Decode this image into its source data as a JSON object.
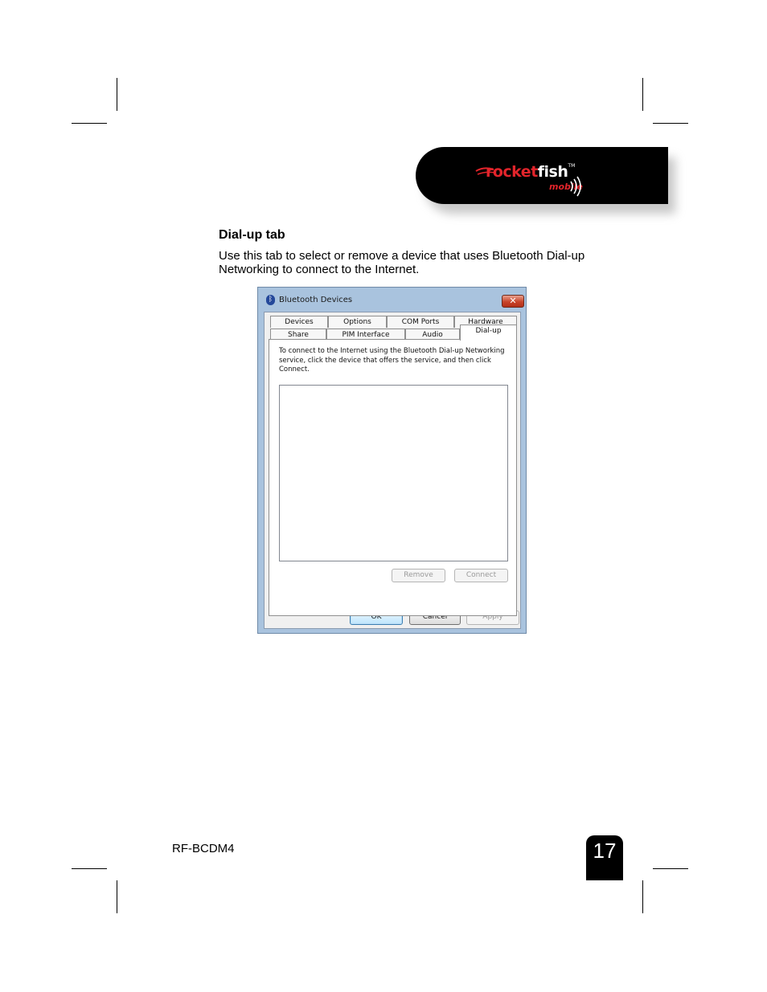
{
  "header": {
    "logo_rocket": "rocket",
    "logo_fish": "fish",
    "logo_tm": "TM",
    "logo_mobile": "mobile"
  },
  "section": {
    "heading": "Dial-up tab",
    "body": "Use this tab to select or remove a device that uses Bluetooth Dial-up Networking to connect to the Internet."
  },
  "dialog": {
    "title": "Bluetooth Devices",
    "tabs_row1": [
      "Devices",
      "Options",
      "COM Ports",
      "Hardware"
    ],
    "tabs_row2": [
      "Share",
      "PIM Interface",
      "Audio",
      "Dial-up"
    ],
    "active_tab": "Dial-up",
    "instructions": "To connect to the Internet using the Bluetooth Dial-up Networking service, click the device that offers the service, and then click Connect.",
    "remove_label": "Remove",
    "connect_label": "Connect",
    "ok_label": "OK",
    "cancel_label": "Cancel",
    "apply_label": "Apply"
  },
  "footer": {
    "model": "RF-BCDM4",
    "page_number": "17"
  },
  "colors": {
    "brand_red": "#e2242b",
    "titlebar": "#a9c3de"
  }
}
